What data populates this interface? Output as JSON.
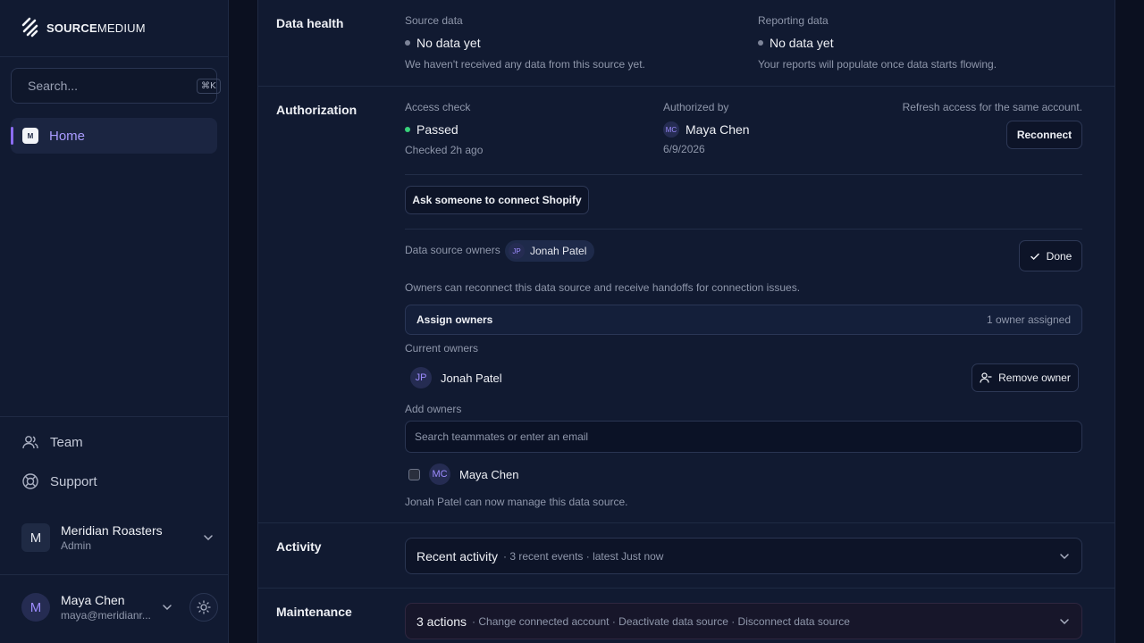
{
  "brand": {
    "name_bold": "SOURCE",
    "name_light": "MEDIUM"
  },
  "sidebar": {
    "search_placeholder": "Search...",
    "search_shortcut": "⌘K",
    "home_icon_text": "M",
    "home_label": "Home",
    "team_label": "Team",
    "support_label": "Support",
    "org": {
      "avatar": "M",
      "name": "Meridian Roasters",
      "role": "Admin"
    },
    "user": {
      "avatar": "M",
      "name": "Maya Chen",
      "email": "maya@meridianr..."
    }
  },
  "data_health": {
    "title": "Data health",
    "source_label": "Source data",
    "source_value": "No data yet",
    "source_note": "We haven't received any data from this source yet.",
    "reporting_label": "Reporting data",
    "reporting_value": "No data yet",
    "reporting_note": "Your reports will populate once data starts flowing."
  },
  "authorization": {
    "title": "Authorization",
    "access_label": "Access check",
    "access_value": "Passed",
    "access_note": "Checked 2h ago",
    "authorized_label": "Authorized by",
    "authorized_initials": "MC",
    "authorized_name": "Maya Chen",
    "authorized_date": "6/9/2026",
    "refresh_note": "Refresh access for the same account.",
    "reconnect_button": "Reconnect",
    "ask_button": "Ask someone to connect Shopify",
    "owners_label": "Data source owners",
    "owner_chip_initials": "JP",
    "owner_chip_name": "Jonah Patel",
    "done_button": "Done",
    "owners_help": "Owners can reconnect this data source and receive handoffs for connection issues.",
    "assign_title": "Assign owners",
    "assign_count": "1 owner assigned",
    "current_owners_label": "Current owners",
    "current_owner_initials": "JP",
    "current_owner_name": "Jonah Patel",
    "remove_button": "Remove owner",
    "add_owners_label": "Add owners",
    "add_placeholder": "Search teammates or enter an email",
    "candidate_initials": "MC",
    "candidate_name": "Maya Chen",
    "status_message": "Jonah Patel can now manage this data source."
  },
  "activity": {
    "title": "Activity",
    "card_title": "Recent activity",
    "card_sub": "· 3 recent events · latest Just now"
  },
  "maintenance": {
    "title": "Maintenance",
    "card_title": "3 actions",
    "card_sub": "· Change connected account · Deactivate data source · Disconnect data source"
  },
  "colors": {
    "accent": "#8b6cf2",
    "success": "#38d27a",
    "background": "#0b1020",
    "panel": "#111a31"
  }
}
